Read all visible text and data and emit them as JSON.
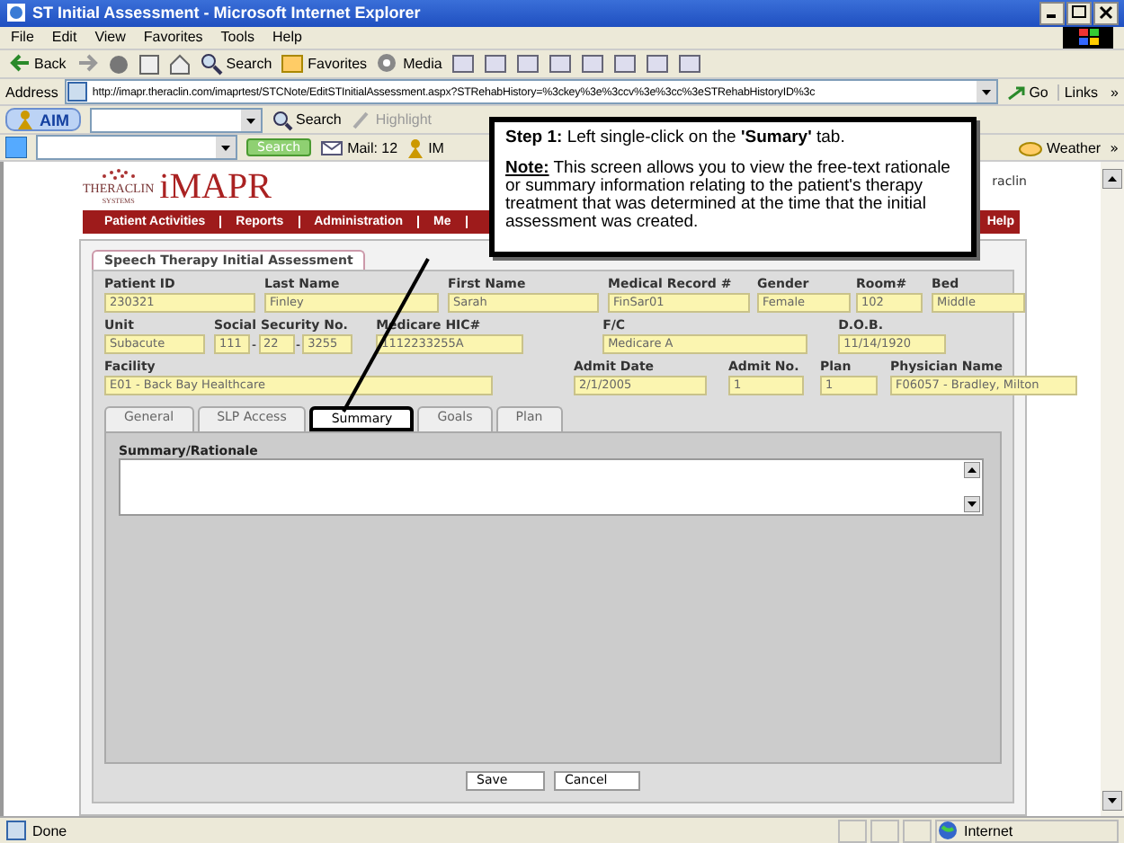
{
  "window": {
    "title": "ST Initial Assessment - Microsoft Internet Explorer"
  },
  "menu_bar": [
    "File",
    "Edit",
    "View",
    "Favorites",
    "Tools",
    "Help"
  ],
  "toolbar": [
    {
      "label": "Back",
      "kind": "back"
    },
    {
      "kind": "forward"
    },
    {
      "label": "Search",
      "kind": "search"
    },
    {
      "label": "Favorites",
      "kind": "favorites"
    },
    {
      "label": "Media",
      "kind": "media"
    }
  ],
  "address_bar": {
    "label": "Address",
    "value": "http://imapr.theraclin.com/imaprtest/STCNote/EditSTInitialAssessment.aspx?STRehabHistory=%3ckey%3e%3ccv%3e%3cc%3eSTRehabHistoryID%3c",
    "go": "Go",
    "links": "Links",
    "chevron": "»"
  },
  "aim_bar": {
    "brand": "AIM",
    "search": "Search",
    "highlight": "Highlight"
  },
  "search_bar": {
    "search": "Search",
    "mail": "Mail: 12",
    "im": "IM",
    "weather": "Weather",
    "chevron": "»"
  },
  "site": {
    "logo_small": "THERACLIN",
    "logo_sub": "SYSTEMS",
    "logo": "iMAPR",
    "header_note": "raclin",
    "nav": [
      {
        "label": "Patient Activities"
      },
      {
        "label": "Reports"
      },
      {
        "label": "Administration"
      },
      {
        "label": "Me"
      },
      {
        "label": "Help"
      }
    ],
    "form_title": "Speech Therapy Initial Assessment",
    "field_rows": [
      [
        {
          "label": "Patient ID",
          "value": "230321"
        },
        {
          "label": "Last Name",
          "value": "Finley"
        },
        {
          "label": "First Name",
          "value": "Sarah"
        },
        {
          "label": "Medical Record #",
          "value": "FinSar01"
        },
        {
          "label": "Gender",
          "value": "Female"
        },
        {
          "label": "Room#",
          "value": "102"
        },
        {
          "label": "Bed",
          "value": "Middle"
        }
      ],
      [
        {
          "label": "Unit",
          "value": "Subacute"
        },
        {
          "label": "Social Security No.",
          "kind": "ssn",
          "parts": [
            "111",
            "22",
            "3255"
          ],
          "separator": "-"
        },
        {
          "label": "Medicare HIC#",
          "value": "1112233255A"
        },
        {
          "label": "F/C",
          "value": "Medicare A"
        },
        {
          "label": "D.O.B.",
          "value": "11/14/1920"
        }
      ],
      [
        {
          "label": "Facility",
          "value": "E01 - Back Bay Healthcare"
        },
        {
          "label": "Admit Date",
          "value": "2/1/2005"
        },
        {
          "label": "Admit No.",
          "value": "1"
        },
        {
          "label": "Plan",
          "value": "1"
        },
        {
          "label": "Physician Name",
          "value": "F06057 - Bradley, Milton"
        }
      ]
    ],
    "tabs": [
      {
        "label": "General",
        "selected": false
      },
      {
        "label": "SLP Access",
        "selected": false
      },
      {
        "label": "Summary",
        "selected": true
      },
      {
        "label": "Goals",
        "selected": false
      },
      {
        "label": "Plan",
        "selected": false
      }
    ],
    "summary_label": "Summary/Rationale",
    "buttons": [
      "Save",
      "Cancel"
    ]
  },
  "callout": {
    "step": "Step 1:",
    "step_text": "Left single-click on the **'Sumary'** tab.",
    "note": "Note:",
    "note_text": "This screen allows you to view the free-text rationale or summary information relating to the patient's therapy treatment that was determined at the time that the initial assessment was created."
  },
  "status_bar": {
    "text": "Done",
    "zone": "Internet"
  }
}
